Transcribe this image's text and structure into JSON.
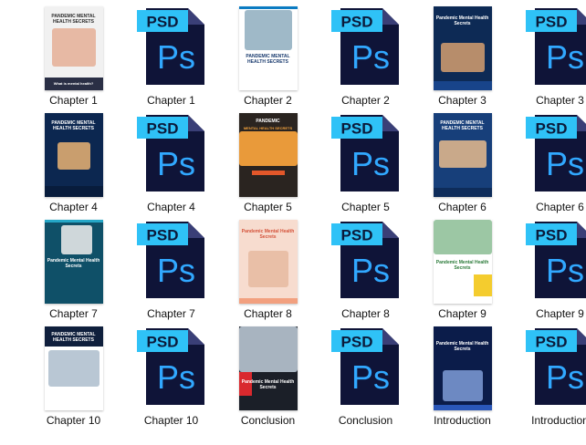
{
  "files": [
    {
      "label": "Chapter 1",
      "kind": "cover",
      "style": "c1",
      "cover_title": "PANDEMIC MENTAL HEALTH SECRETS",
      "cover_footer": "What is mental health?"
    },
    {
      "label": "Chapter 1",
      "kind": "psd"
    },
    {
      "label": "Chapter 2",
      "kind": "cover",
      "style": "c2",
      "cover_title": "PANDEMIC MENTAL HEALTH SECRETS"
    },
    {
      "label": "Chapter 2",
      "kind": "psd"
    },
    {
      "label": "Chapter 3",
      "kind": "cover",
      "style": "c3",
      "cover_title": "Pandemic Mental Health Secrets"
    },
    {
      "label": "Chapter 3",
      "kind": "psd"
    },
    {
      "label": "Chapter 4",
      "kind": "cover",
      "style": "c4",
      "cover_title": "PANDEMIC MENTAL HEALTH SECRETS"
    },
    {
      "label": "Chapter 4",
      "kind": "psd"
    },
    {
      "label": "Chapter 5",
      "kind": "cover",
      "style": "c5",
      "cover_title": "PANDEMIC",
      "cover_subtitle": "MENTAL HEALTH SECRETS"
    },
    {
      "label": "Chapter 5",
      "kind": "psd"
    },
    {
      "label": "Chapter 6",
      "kind": "cover",
      "style": "c6",
      "cover_title": "PANDEMIC MENTAL HEALTH SECRETS"
    },
    {
      "label": "Chapter 6",
      "kind": "psd"
    },
    {
      "label": "Chapter 7",
      "kind": "cover",
      "style": "c7",
      "cover_title": "Pandemic Mental Health Secrets"
    },
    {
      "label": "Chapter 7",
      "kind": "psd"
    },
    {
      "label": "Chapter 8",
      "kind": "cover",
      "style": "c8",
      "cover_title": "Pandemic Mental Health Secrets"
    },
    {
      "label": "Chapter 8",
      "kind": "psd"
    },
    {
      "label": "Chapter 9",
      "kind": "cover",
      "style": "c9",
      "cover_title": "Pandemic Mental Health Secrets"
    },
    {
      "label": "Chapter 9",
      "kind": "psd"
    },
    {
      "label": "Chapter 10",
      "kind": "cover",
      "style": "c10",
      "cover_title": "PANDEMIC MENTAL HEALTH SECRETS"
    },
    {
      "label": "Chapter 10",
      "kind": "psd"
    },
    {
      "label": "Conclusion",
      "kind": "cover",
      "style": "c11",
      "cover_title": "Pandemic Mental Health Secrets"
    },
    {
      "label": "Conclusion",
      "kind": "psd"
    },
    {
      "label": "Introduction",
      "kind": "cover",
      "style": "c12",
      "cover_title": "Pandemic Mental Health Secrets"
    },
    {
      "label": "Introduction",
      "kind": "psd"
    }
  ],
  "psd_icon": {
    "badge_text": "PSD",
    "logo_text": "Ps",
    "icon": "photoshop-file-icon",
    "colors": {
      "body": "#0f1438",
      "fold": "#3a3f77",
      "badge": "#2fc2f7",
      "badge_text": "#0b1a3a",
      "logo": "#31a8ff"
    }
  }
}
